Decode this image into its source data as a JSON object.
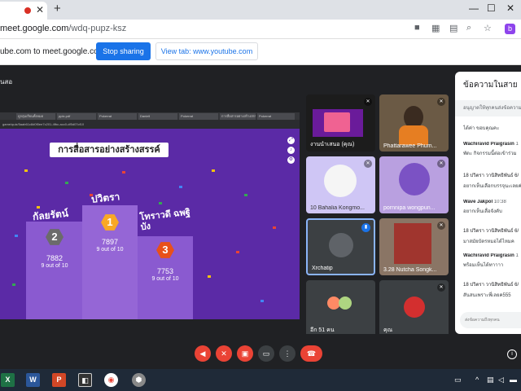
{
  "browser": {
    "url_host": "meet.google.com",
    "url_path": "/wdq-pupz-ksz",
    "profile_initial": "b"
  },
  "sharebar": {
    "message": "ube.com to meet.google.com",
    "stop_label": "Stop sharing",
    "switch_label": "View tab: www.youtube.com"
  },
  "meet": {
    "presenting_label": "นสอ"
  },
  "shared": {
    "inner_tabs": [
      "ดูกลุ่มเรียนทั้งหมด",
      "pptx.pdf",
      "Pokerrat",
      "Daniell",
      "Pokerrat",
      "การสื่อสารอย่างสร้างสรรค์",
      "Pokerrat"
    ],
    "inner_url": "game/quiz/5aab61c8d0f0ee7c201-4fbc-acc0-df5d07cf10",
    "quiz_title": "การสื่อสารอย่างสร้างสรรค์",
    "podium": [
      {
        "name": "ปวิตรา",
        "rank": "1",
        "score": "7897",
        "out_of": "9 out of 10"
      },
      {
        "name": "กัลยรัตน์",
        "rank": "2",
        "score": "7882",
        "out_of": "9 out of 10"
      },
      {
        "name": "โทราวดี ฉพฐิ\nบัง",
        "rank": "3",
        "score": "7753",
        "out_of": "9 out of 10"
      }
    ]
  },
  "participants": [
    {
      "name": "งานนำเสนอ (คุณ)"
    },
    {
      "name": "Phattarawee Phum..."
    },
    {
      "name": "10 Bahalia Kongmo..."
    },
    {
      "name": "pornnipa wongpun..."
    },
    {
      "name": "Xrchatip"
    },
    {
      "name": "3.28 Nutcha Songk..."
    },
    {
      "name": "อีก 51 คน"
    },
    {
      "name": "คุณ"
    }
  ],
  "chat": {
    "title": "ข้อความในสาย",
    "toggle_label": "อนุญาตให้ทุกคนส่งข้อความ",
    "messages": [
      {
        "sender": "",
        "time": "",
        "text": "ได้ค่า ขอบคุณคะ"
      },
      {
        "sender": "Wachiravid Praigrasin",
        "time": "1",
        "text": "พัดะ กิจกรรมนี้ต่อเข้าร่วม"
      },
      {
        "sender": "18 ปวิตรา วานิสิทธิพันธ์ 6/",
        "time": "",
        "text": "อยากเห็นเลือกบรรจุนะเลยค่ะ"
      },
      {
        "sender": "Wave Jakpol",
        "time": "10:38",
        "text": "อยากเห็นเลื่อจังคับ"
      },
      {
        "sender": "18 ปวิตรา วานิสิทธิพันธ์ 6/",
        "time": "",
        "text": "มาสมัยบัตรหมอได้ไหมค"
      },
      {
        "sender": "Wachiravid Praigrasin",
        "time": "1",
        "text": "พร้อมเห็นได้ทาาาา"
      },
      {
        "sender": "18 ปวิตรา วานิสิทธิพันธ์ 6/",
        "time": "",
        "text": "สันสนเพราะพี่เลยค555"
      }
    ],
    "input_placeholder": "ส่งข้อความถึงทุกคน"
  },
  "colors": {
    "accent": "#1a73e8",
    "danger": "#ea4335",
    "meet_bg": "#202124",
    "quiz_bg": "#5b2aa6"
  }
}
